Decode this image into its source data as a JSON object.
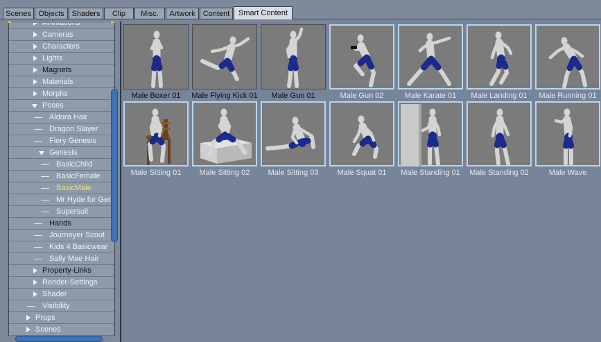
{
  "tabs": [
    {
      "label": "Scenes",
      "active": false
    },
    {
      "label": "Objects",
      "active": false
    },
    {
      "label": "Shaders",
      "active": false
    },
    {
      "label": "Clip",
      "active": false
    },
    {
      "label": "Misc.",
      "active": false
    },
    {
      "label": "Artwork",
      "active": false
    },
    {
      "label": "Content",
      "active": false
    },
    {
      "label": "Smart Content",
      "active": true
    }
  ],
  "tree": [
    {
      "label": "Animations",
      "level": 2,
      "expander": "right",
      "style": "light"
    },
    {
      "label": "Cameras",
      "level": 2,
      "expander": "right",
      "style": "light"
    },
    {
      "label": "Characters",
      "level": 2,
      "expander": "right",
      "style": "light"
    },
    {
      "label": "Lights",
      "level": 2,
      "expander": "right",
      "style": "light"
    },
    {
      "label": "Magnets",
      "level": 2,
      "expander": "right",
      "style": "dark"
    },
    {
      "label": "Materials",
      "level": 2,
      "expander": "right",
      "style": "light"
    },
    {
      "label": "Morphs",
      "level": 2,
      "expander": "right",
      "style": "light"
    },
    {
      "label": "Poses",
      "level": 2,
      "expander": "down",
      "style": "light"
    },
    {
      "label": "Aldora Hair",
      "level": 3,
      "expander": "none",
      "style": "light"
    },
    {
      "label": "Dragon Slayer",
      "level": 3,
      "expander": "none",
      "style": "light"
    },
    {
      "label": "Fiery Genesis",
      "level": 3,
      "expander": "none",
      "style": "light"
    },
    {
      "label": "Genesis",
      "level": 3,
      "expander": "down",
      "style": "light"
    },
    {
      "label": "BasicChild",
      "level": 4,
      "expander": "none",
      "style": "light"
    },
    {
      "label": "BasicFemale",
      "level": 4,
      "expander": "none",
      "style": "light"
    },
    {
      "label": "BasicMale",
      "level": 4,
      "expander": "none",
      "style": "selected"
    },
    {
      "label": "Mr Hyde for Genesis",
      "level": 4,
      "expander": "none",
      "style": "light"
    },
    {
      "label": "Supersuit",
      "level": 4,
      "expander": "none",
      "style": "light"
    },
    {
      "label": "Hands",
      "level": 3,
      "expander": "none",
      "style": "dark"
    },
    {
      "label": "Journeyer Scout",
      "level": 3,
      "expander": "none",
      "style": "light"
    },
    {
      "label": "Kids 4 Basicwear",
      "level": 3,
      "expander": "none",
      "style": "light"
    },
    {
      "label": "Sally Mae Hair",
      "level": 3,
      "expander": "none",
      "style": "light"
    },
    {
      "label": "Property-Links",
      "level": 2,
      "expander": "right",
      "style": "dark"
    },
    {
      "label": "Render-Settings",
      "level": 2,
      "expander": "right",
      "style": "light"
    },
    {
      "label": "Shader",
      "level": 2,
      "expander": "right",
      "style": "light"
    },
    {
      "label": "Visibility",
      "level": 2,
      "expander": "none",
      "style": "light"
    },
    {
      "label": "Props",
      "level": 1,
      "expander": "right",
      "style": "light"
    },
    {
      "label": "Scenes",
      "level": 1,
      "expander": "right",
      "style": "light"
    }
  ],
  "items": [
    {
      "label": "Male Boxer 01",
      "pose": "boxer",
      "style": "dark",
      "prop": ""
    },
    {
      "label": "Male Flying Kick 01",
      "pose": "kick",
      "style": "dark",
      "prop": ""
    },
    {
      "label": "Male Gun 01",
      "pose": "gun1",
      "style": "dark",
      "prop": ""
    },
    {
      "label": "Male Gun 02",
      "pose": "gun2",
      "style": "light",
      "prop": ""
    },
    {
      "label": "Male Karate 01",
      "pose": "karate",
      "style": "light",
      "prop": ""
    },
    {
      "label": "Male Landing 01",
      "pose": "landing",
      "style": "light",
      "prop": ""
    },
    {
      "label": "Male Running 01",
      "pose": "running",
      "style": "light",
      "prop": ""
    },
    {
      "label": "Male Sitting 01",
      "pose": "sit1",
      "style": "light",
      "prop": "chair"
    },
    {
      "label": "Male Sitting 02",
      "pose": "sit2",
      "style": "light",
      "prop": "box"
    },
    {
      "label": "Male Sitting 03",
      "pose": "sit3",
      "style": "light",
      "prop": ""
    },
    {
      "label": "Male Squat 01",
      "pose": "squat",
      "style": "light",
      "prop": ""
    },
    {
      "label": "Male Standing 01",
      "pose": "stand1",
      "style": "light",
      "prop": "wall"
    },
    {
      "label": "Male Standing 02",
      "pose": "stand2",
      "style": "light",
      "prop": ""
    },
    {
      "label": "Male Wave",
      "pose": "wave",
      "style": "light",
      "prop": ""
    }
  ],
  "colors": {
    "shorts": "#1c2a8c",
    "skin": "#d4d4d4",
    "selected_text": "#f4df73",
    "accent_scroll": "#3f72b8"
  }
}
